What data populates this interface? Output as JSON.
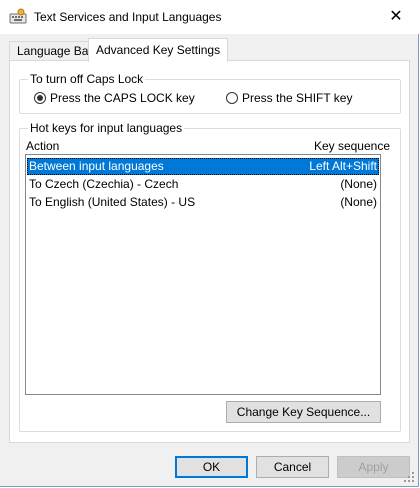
{
  "window": {
    "title": "Text Services and Input Languages",
    "close_label": "✕"
  },
  "tabs": [
    {
      "label": "Language Bar"
    },
    {
      "label": "Advanced Key Settings"
    }
  ],
  "caps_lock": {
    "group_label": "To turn off Caps Lock",
    "options": [
      {
        "label": "Press the CAPS LOCK key",
        "checked": true
      },
      {
        "label": "Press the SHIFT key",
        "checked": false
      }
    ]
  },
  "hotkeys": {
    "group_label": "Hot keys for input languages",
    "columns": {
      "action": "Action",
      "sequence": "Key sequence"
    },
    "rows": [
      {
        "action": "Between input languages",
        "sequence": "Left Alt+Shift",
        "selected": true
      },
      {
        "action": "To Czech (Czechia) - Czech",
        "sequence": "(None)",
        "selected": false
      },
      {
        "action": "To English (United States) - US",
        "sequence": "(None)",
        "selected": false
      }
    ],
    "change_button": "Change Key Sequence..."
  },
  "footer": {
    "ok": "OK",
    "cancel": "Cancel",
    "apply": "Apply"
  },
  "colors": {
    "selection": "#0078d7",
    "default_button_border": "#0078d7"
  },
  "icons": {
    "app": "keyboard-icon",
    "close": "close-icon",
    "resize": "resize-grip-icon"
  }
}
